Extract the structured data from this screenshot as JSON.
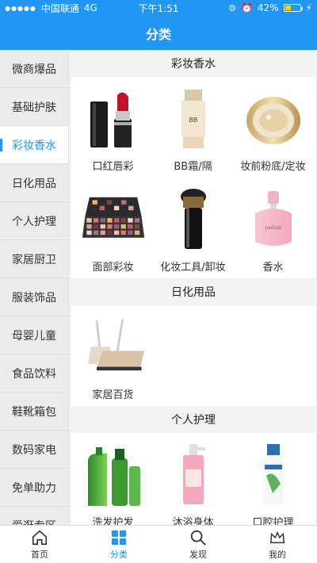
{
  "status": {
    "carrier": "中国联通",
    "network": "4G",
    "time": "下午1:51",
    "battery": "42%",
    "battery_level": 0.42
  },
  "header": {
    "title": "分类"
  },
  "sidebar": {
    "items": [
      {
        "label": "微商爆品"
      },
      {
        "label": "基础护肤"
      },
      {
        "label": "彩妆香水",
        "active": true
      },
      {
        "label": "日化用品"
      },
      {
        "label": "个人护理"
      },
      {
        "label": "家居厨卫"
      },
      {
        "label": "服装饰品"
      },
      {
        "label": "母婴儿童"
      },
      {
        "label": "食品饮料"
      },
      {
        "label": "鞋靴箱包"
      },
      {
        "label": "数码家电"
      },
      {
        "label": "免单助力"
      },
      {
        "label": "爱逛专区"
      }
    ]
  },
  "sections": [
    {
      "title": "彩妆香水",
      "items": [
        {
          "label": "口红唇彩",
          "icon": "lipstick-image"
        },
        {
          "label": "BB霜/隔",
          "icon": "bb-cream-image"
        },
        {
          "label": "妆前粉底/定妆",
          "icon": "cushion-compact-image"
        },
        {
          "label": "面部彩妆",
          "icon": "eyeshadow-palette-image"
        },
        {
          "label": "化妆工具/卸妆",
          "icon": "makeup-brush-image"
        },
        {
          "label": "香水",
          "icon": "perfume-image"
        }
      ]
    },
    {
      "title": "日化用品",
      "items": [
        {
          "label": "家居百货",
          "icon": "broom-dustpan-image"
        }
      ]
    },
    {
      "title": "个人护理",
      "items": [
        {
          "label": "洗发护发",
          "icon": "shampoo-image"
        },
        {
          "label": "沐浴身体",
          "icon": "body-wash-image"
        },
        {
          "label": "口腔护理",
          "icon": "mouthwash-image"
        }
      ]
    }
  ],
  "tabbar": {
    "items": [
      {
        "label": "首页",
        "icon": "home-icon"
      },
      {
        "label": "分类",
        "icon": "category-icon",
        "active": true
      },
      {
        "label": "发现",
        "icon": "search-icon"
      },
      {
        "label": "我的",
        "icon": "crown-icon"
      }
    ]
  },
  "colors": {
    "brand": "#2196f3",
    "sidebar_bg": "#ebebeb",
    "page_bg": "#f2f2f2"
  }
}
